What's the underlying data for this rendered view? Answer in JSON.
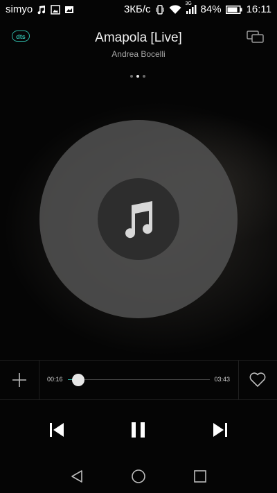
{
  "status_bar": {
    "carrier": "simyo",
    "network_speed": "3КБ/с",
    "network_type": "3G",
    "battery": "84%",
    "time": "16:11"
  },
  "header": {
    "dts_label": "dts"
  },
  "song": {
    "title": "Amapola [Live]",
    "artist": "Andrea Bocelli"
  },
  "pager": {
    "count": 3,
    "active_index": 1
  },
  "playback": {
    "current_time": "00:16",
    "total_time": "03:43",
    "progress_fraction": 0.072
  },
  "colors": {
    "accent": "#2fb6a6",
    "background": "#050505"
  }
}
